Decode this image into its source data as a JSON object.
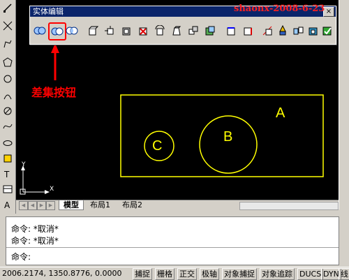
{
  "solid_toolbar": {
    "title": "实体编辑",
    "close_label": "×",
    "buttons": [
      {
        "icon": "union-icon"
      },
      {
        "icon": "subtract-icon",
        "highlighted": true
      },
      {
        "icon": "intersect-icon"
      },
      {
        "icon": "extrude-faces-icon"
      },
      {
        "icon": "move-faces-icon"
      },
      {
        "icon": "offset-faces-icon"
      },
      {
        "icon": "delete-faces-icon"
      },
      {
        "icon": "rotate-faces-icon"
      },
      {
        "icon": "taper-faces-icon"
      },
      {
        "icon": "copy-faces-icon"
      },
      {
        "icon": "color-faces-icon"
      },
      {
        "icon": "copy-edges-icon"
      },
      {
        "icon": "color-edges-icon"
      },
      {
        "icon": "imprint-icon"
      },
      {
        "icon": "clean-icon"
      },
      {
        "icon": "separate-icon"
      },
      {
        "icon": "shell-icon"
      },
      {
        "icon": "check-icon"
      }
    ]
  },
  "watermark": "shaonx-2008-6-23",
  "annotation": {
    "label": "差集按钮",
    "color": "#ff0000"
  },
  "drawing": {
    "labels": {
      "rect": "A",
      "big_circle": "B",
      "small_circle": "C"
    },
    "stroke_color": "#ffff00",
    "ucs_y": "Y",
    "ucs_x": "X"
  },
  "tabs": {
    "active": "模型",
    "others": [
      "布局1",
      "布局2"
    ]
  },
  "command_history": [
    "命令: *取消*",
    "命令: *取消*"
  ],
  "command_prompt": "命令:",
  "status_bar": {
    "coordinates": "2006.2174, 1350.8776, 0.0000",
    "buttons": [
      "捕捉",
      "栅格",
      "正交",
      "极轴",
      "对象捕捉",
      "对象追踪",
      "DUCS",
      "DYN",
      "线"
    ]
  },
  "left_tools": [
    "line-icon",
    "xline-icon",
    "polyline-icon",
    "polygon-icon",
    "rectangle-icon",
    "arc-icon",
    "circle-icon",
    "revcloud-icon",
    "spline-icon",
    "ellipse-icon",
    "ellipse-arc-icon",
    "insert-block-icon",
    "make-block-icon",
    "point-icon",
    "hatch-icon",
    "gradient-icon",
    "region-icon",
    "table-icon",
    "mtext-icon"
  ]
}
